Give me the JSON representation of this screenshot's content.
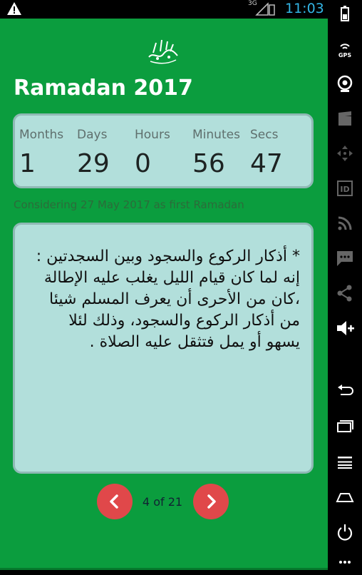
{
  "status_bar": {
    "network": "3G",
    "time": "11:03",
    "time_color": "#33b5e5"
  },
  "app": {
    "background_color": "#0b9d3e",
    "emblem_icon": "arabic-calligraphy-emblem-icon",
    "title": "Ramadan 2017",
    "countdown": {
      "labels": [
        "Months",
        "Days",
        "Hours",
        "Minutes",
        "Secs"
      ],
      "values": [
        "1",
        "29",
        "0",
        "56",
        "47"
      ]
    },
    "note": "Considering 27 May 2017 as first Ramadan",
    "content_text": "* أذكار الركوع والسجود وبين السجدتين : إنه لما كان قيام الليل يغلب عليه الإطالة ،كان من الأحرى أن يعرف المسلم شيئا من أذكار الركوع والسجود، وذلك لئلا يسهو أو يمل فتثقل عليه الصلاة .",
    "pager": {
      "indicator": "4 of 21",
      "button_color": "#e0484a"
    }
  },
  "side_bar": {
    "icons": [
      "battery-icon",
      "gps-icon",
      "camera-icon",
      "clapperboard-icon",
      "dpad-icon",
      "id-icon",
      "rss-icon",
      "sms-icon",
      "share-icon",
      "volume-up-icon",
      "back-icon",
      "recent-apps-icon",
      "menu-icon",
      "home-icon",
      "power-icon",
      "more-icon"
    ]
  }
}
